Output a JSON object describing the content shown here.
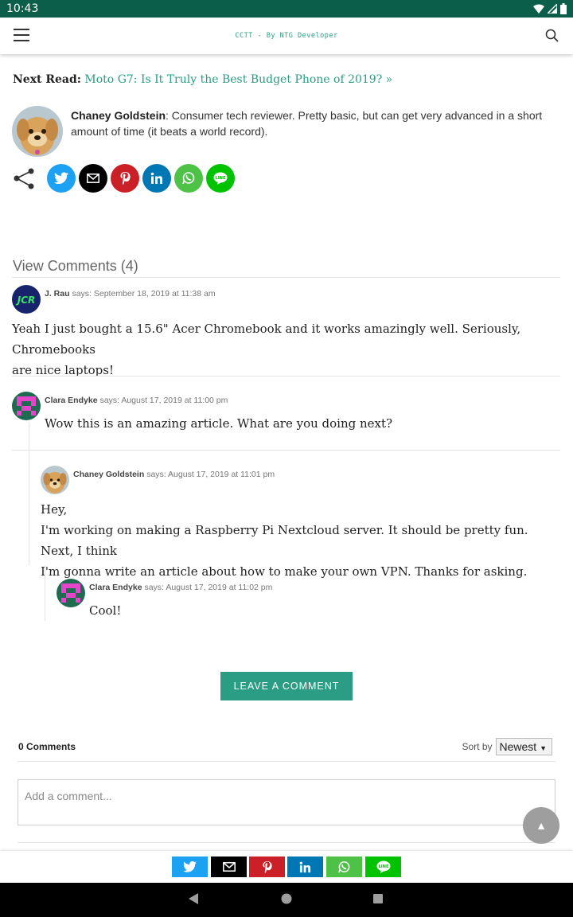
{
  "status_bar": {
    "time": "10:43"
  },
  "header": {
    "site_title": "CCTT - By NTG Developer"
  },
  "next_read": {
    "label": "Next Read:",
    "link_text": "Moto G7: Is It Truly the Best Budget Phone of 2019? »"
  },
  "author": {
    "name": "Chaney Goldstein",
    "bio": ": Consumer tech reviewer. Pretty basic, but can get very advanced in a short amount of time (it beats a world record)."
  },
  "share_buttons": [
    "twitter-icon",
    "email-icon",
    "pinterest-icon",
    "linkedin-icon",
    "whatsapp-icon",
    "line-icon"
  ],
  "share_colors": {
    "twitter": "#1da1f2",
    "email": "#000000",
    "pinterest": "#cb2027",
    "linkedin": "#0077b5",
    "whatsapp": "#4dc247",
    "line": "#00c300"
  },
  "comments": {
    "heading": "View Comments (4)",
    "says": "says:",
    "items": [
      {
        "author": "J. Rau",
        "date": "September 18, 2019 at 11:38 am",
        "avatar_text": "JCR",
        "lines": [
          "Yeah I just bought a 15.6\" Acer Chromebook and it works amazingly well. Seriously, Chromebooks",
          "are nice laptops!"
        ]
      },
      {
        "author": "Clara Endyke",
        "date": "August 17, 2019 at 11:00 pm",
        "lines": [
          "Wow this is an amazing article. What are you doing next?"
        ]
      },
      {
        "author": "Chaney Goldstein",
        "date": "August 17, 2019 at 11:01 pm",
        "lines": [
          "Hey,",
          "I'm working on making a Raspberry Pi Nextcloud server. It should be pretty fun. Next, I think",
          "I'm gonna write an article about how to make your own VPN. Thanks for asking."
        ]
      },
      {
        "author": "Clara Endyke",
        "date": "August 17, 2019 at 11:02 pm",
        "lines": [
          "Cool!"
        ]
      }
    ]
  },
  "leave_comment_label": "LEAVE A COMMENT",
  "fb_comments": {
    "count_label": "0 Comments",
    "sort_label": "Sort by",
    "sort_value": "Newest",
    "input_placeholder": "Add a comment..."
  },
  "accent_color": "#2a9d84",
  "status_bar_color": "#0b5e49"
}
